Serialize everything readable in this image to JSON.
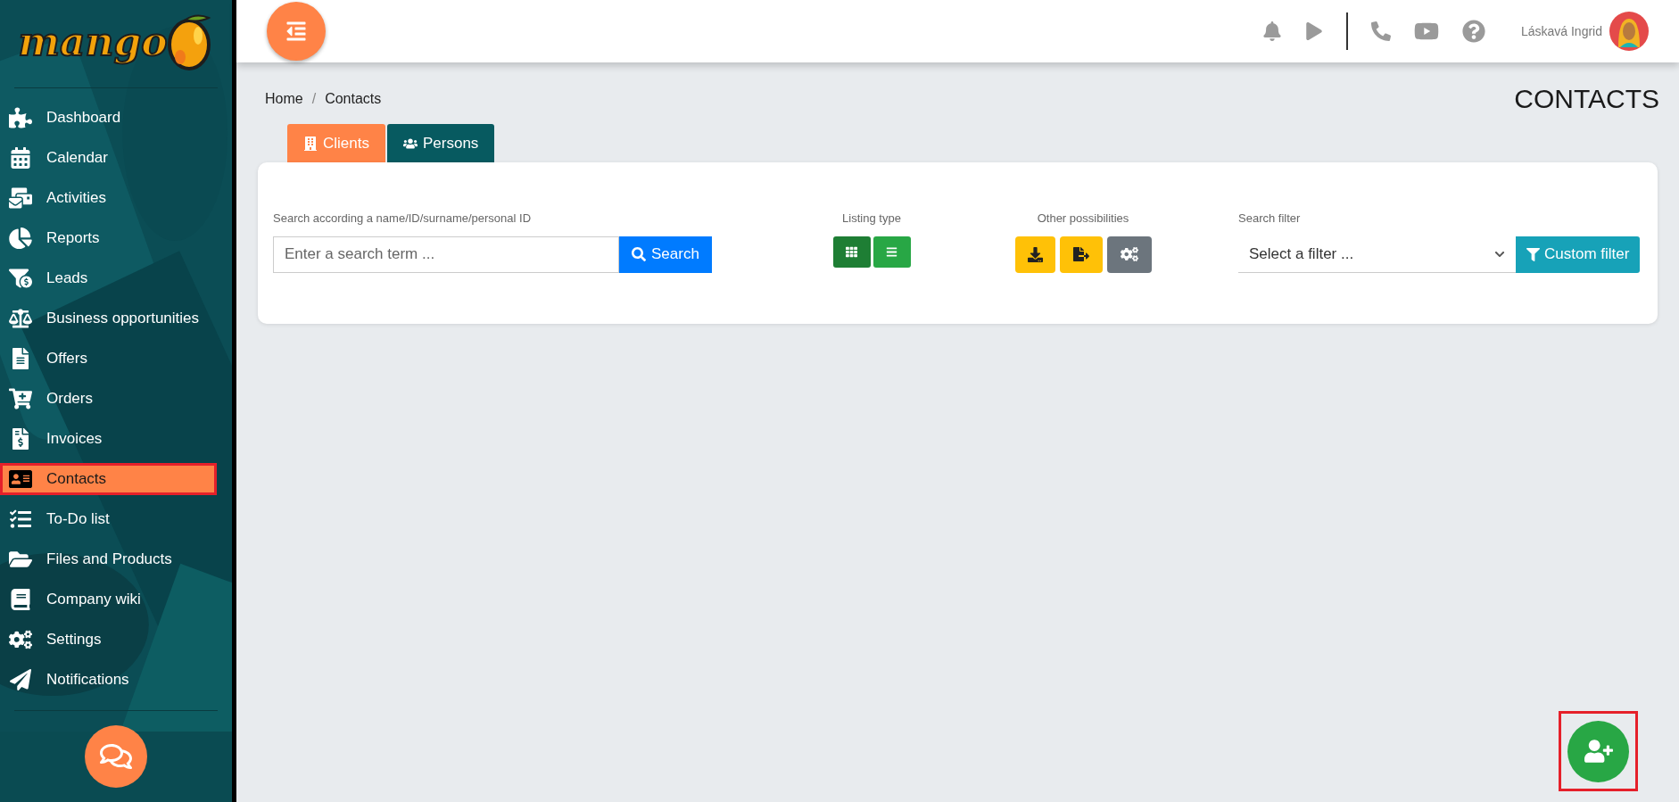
{
  "logo": {
    "text": "mango"
  },
  "sidebar": {
    "items": [
      {
        "label": "Dashboard",
        "selected": false,
        "highlighted": false
      },
      {
        "label": "Calendar",
        "selected": false,
        "highlighted": false
      },
      {
        "label": "Activities",
        "selected": false,
        "highlighted": false
      },
      {
        "label": "Reports",
        "selected": false,
        "highlighted": false
      },
      {
        "label": "Leads",
        "selected": false,
        "highlighted": false
      },
      {
        "label": "Business opportunities",
        "selected": false,
        "highlighted": false
      },
      {
        "label": "Offers",
        "selected": false,
        "highlighted": false
      },
      {
        "label": "Orders",
        "selected": false,
        "highlighted": false
      },
      {
        "label": "Invoices",
        "selected": false,
        "highlighted": false
      },
      {
        "label": "Contacts",
        "selected": true,
        "highlighted": true
      },
      {
        "label": "To-Do list",
        "selected": false,
        "highlighted": false
      },
      {
        "label": "Files and Products",
        "selected": false,
        "highlighted": false
      },
      {
        "label": "Company wiki",
        "selected": false,
        "highlighted": false
      },
      {
        "label": "Settings",
        "selected": false,
        "highlighted": false
      },
      {
        "label": "Notifications",
        "selected": false,
        "highlighted": false
      }
    ]
  },
  "topbar": {
    "user_name": "Láskavá Ingrid"
  },
  "breadcrumb": {
    "items": [
      "Home",
      "Contacts"
    ],
    "separator": "/"
  },
  "page_title": "CONTACTS",
  "tabs": [
    {
      "label": "Clients",
      "selected": true
    },
    {
      "label": "Persons",
      "selected": false
    }
  ],
  "search": {
    "label": "Search according a name/ID/surname/personal ID",
    "placeholder": "Enter a search term ...",
    "button": "Search"
  },
  "listing_type": {
    "label": "Listing type",
    "options": [
      {
        "kind": "grid",
        "selected": true
      },
      {
        "kind": "list",
        "selected": false
      }
    ]
  },
  "other_possibilities": {
    "label": "Other possibilities"
  },
  "search_filter": {
    "label": "Search filter",
    "placeholder": "Select a filter ...",
    "button": "Custom filter"
  },
  "add_button": {
    "highlighted": true
  }
}
